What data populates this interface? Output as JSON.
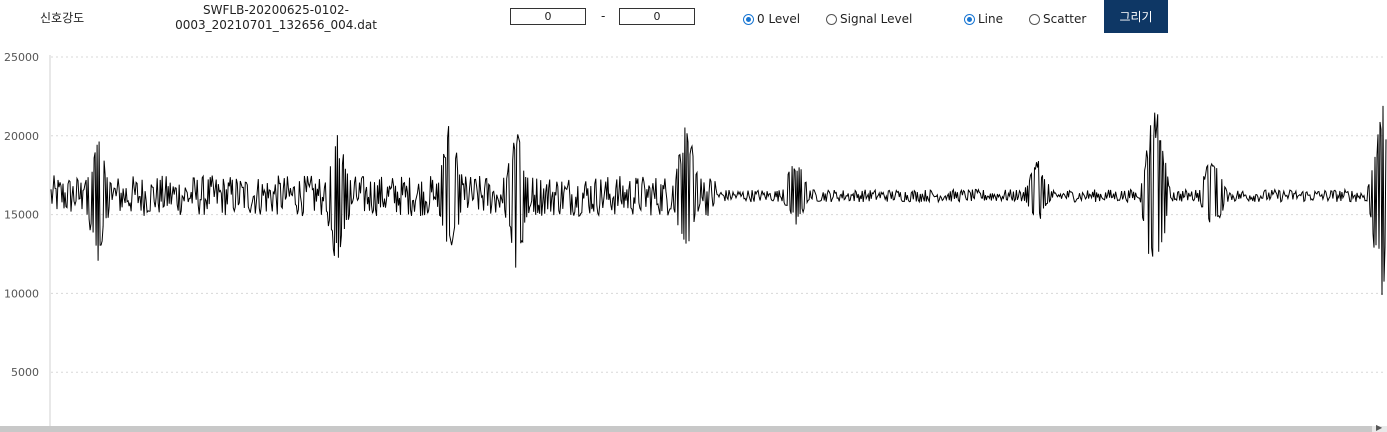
{
  "toolbar": {
    "label": "신호강도",
    "file_name_line1": "SWFLB-20200625-0102-",
    "file_name_line2": "0003_20210701_132656_004.dat",
    "range_start": "0",
    "range_separator": "-",
    "range_end": "0",
    "level_options": [
      {
        "label": "0 Level",
        "selected": true
      },
      {
        "label": "Signal Level",
        "selected": false
      }
    ],
    "plot_type_options": [
      {
        "label": "Line",
        "selected": true
      },
      {
        "label": "Scatter",
        "selected": false
      }
    ],
    "draw_button_label": "그리기",
    "accent_color": "#0e3765",
    "radio_color": "#1976d2"
  },
  "chart_data": {
    "type": "line",
    "series_color": "#000000",
    "grid": true,
    "grid_style": "dotted horizontal",
    "ylim": [
      0,
      25000
    ],
    "yticks": [
      5000,
      10000,
      15000,
      20000,
      25000
    ],
    "ytick_labels": [
      "5000",
      "10000",
      "15000",
      "20000",
      "25000"
    ],
    "baseline": 16200,
    "sample_count": 1334,
    "segments": [
      {
        "from": 0.0,
        "to": 0.5,
        "amplitude": 1300
      },
      {
        "from": 0.5,
        "to": 1.0,
        "amplitude": 400
      }
    ],
    "bursts": [
      {
        "at": 0.035,
        "max": 20100,
        "min": 11900
      },
      {
        "at": 0.215,
        "max": 20500,
        "min": 11100
      },
      {
        "at": 0.299,
        "max": 21100,
        "min": 12300
      },
      {
        "at": 0.349,
        "max": 20500,
        "min": 11200
      },
      {
        "at": 0.476,
        "max": 21100,
        "min": 12200
      },
      {
        "at": 0.558,
        "max": 18900,
        "min": 14200
      },
      {
        "at": 0.739,
        "max": 18700,
        "min": 14400
      },
      {
        "at": 0.827,
        "max": 22500,
        "min": 9800
      },
      {
        "at": 0.87,
        "max": 19100,
        "min": 13500
      },
      {
        "at": 0.997,
        "max": 22300,
        "min": 9600
      }
    ]
  }
}
